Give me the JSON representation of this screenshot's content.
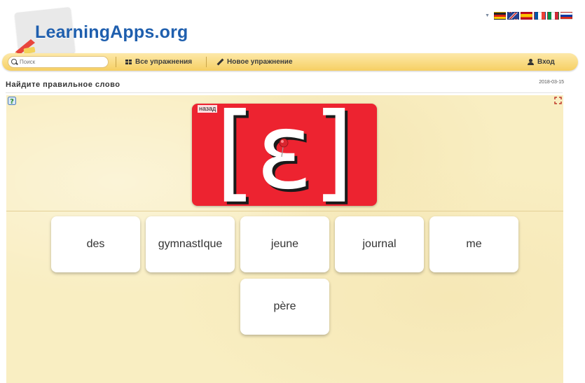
{
  "site": {
    "logo_text": "LearningApps.org"
  },
  "languages": [
    "de-flag-icon",
    "uk-flag-icon",
    "es-flag-icon",
    "fr-flag-icon",
    "it-flag-icon",
    "ru-flag-icon"
  ],
  "nav": {
    "search_placeholder": "Поиск",
    "all_exercises": "Все упражнения",
    "new_exercise": "Новое упражнение",
    "login": "Вход"
  },
  "page": {
    "title": "Найдите правильное слово",
    "date": "2018-03-15"
  },
  "game": {
    "back_label": "назад",
    "symbol": "[ɛ]",
    "card_color": "#ed2330",
    "words": [
      "des",
      "gymnastIque",
      "jeune",
      "journal",
      "me",
      "père"
    ]
  },
  "colors": {
    "nav_bar": "#f6cf63",
    "background": "#f9eec2",
    "logo_blue": "#1f5fae"
  }
}
